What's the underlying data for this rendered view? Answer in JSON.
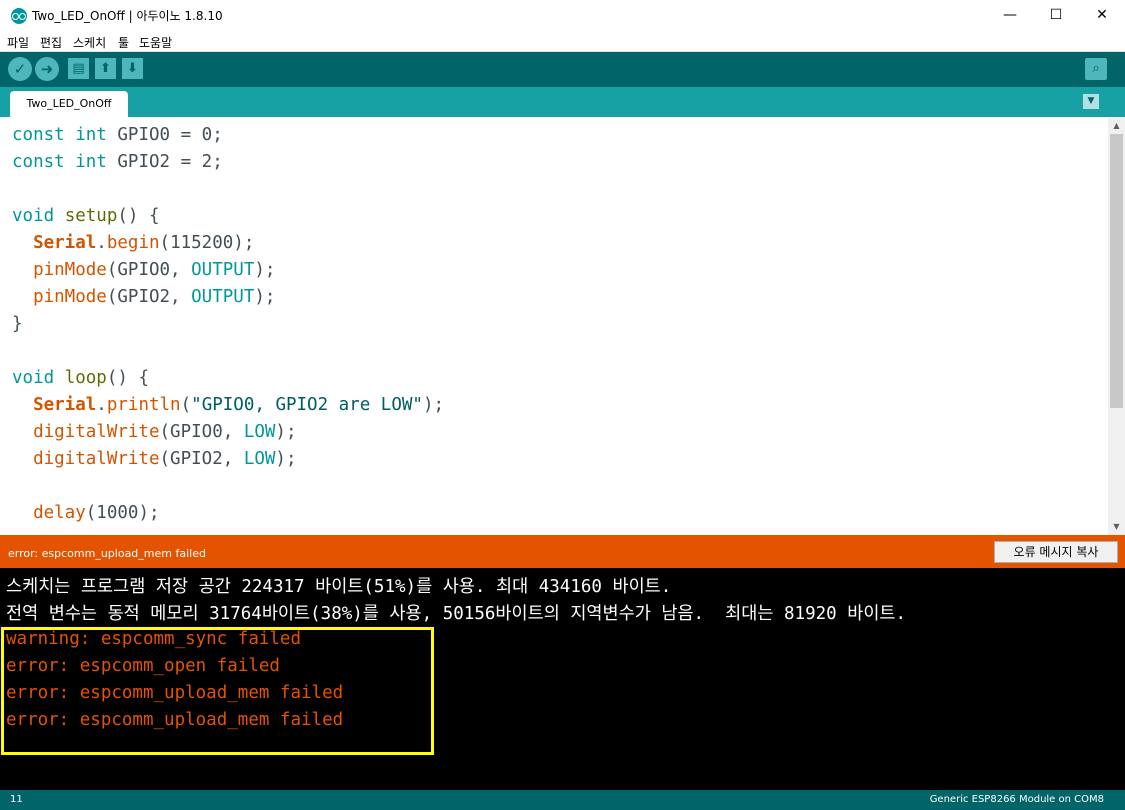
{
  "window": {
    "title": "Two_LED_OnOff | 아두이노 1.8.10",
    "controls": {
      "minimize": "—",
      "maximize": "☐",
      "close": "✕"
    }
  },
  "menu": [
    "파일",
    "편집",
    "스케치",
    "툴",
    "도움말"
  ],
  "toolbar": {
    "verify_icon": "check-icon",
    "upload_icon": "arrow-right-icon",
    "new_icon": "document-icon",
    "open_icon": "arrow-up-icon",
    "save_icon": "arrow-down-icon",
    "serial_monitor_icon": "magnifier-icon"
  },
  "tabs": [
    {
      "label": "Two_LED_OnOff"
    }
  ],
  "editor": {
    "lines": [
      [
        {
          "t": "const",
          "c": "k-type"
        },
        {
          "t": " "
        },
        {
          "t": "int",
          "c": "k-type"
        },
        {
          "t": " GPIO0 = 0;"
        }
      ],
      [
        {
          "t": "const",
          "c": "k-type"
        },
        {
          "t": " "
        },
        {
          "t": "int",
          "c": "k-type"
        },
        {
          "t": " GPIO2 = 2;"
        }
      ],
      [],
      [
        {
          "t": "void",
          "c": "k-type"
        },
        {
          "t": " "
        },
        {
          "t": "setup",
          "c": "k-struct"
        },
        {
          "t": "() {"
        }
      ],
      [
        {
          "t": "  "
        },
        {
          "t": "Serial",
          "c": "k-obj"
        },
        {
          "t": "."
        },
        {
          "t": "begin",
          "c": "k-fn"
        },
        {
          "t": "(115200);"
        }
      ],
      [
        {
          "t": "  "
        },
        {
          "t": "pinMode",
          "c": "k-fn"
        },
        {
          "t": "(GPIO0, "
        },
        {
          "t": "OUTPUT",
          "c": "k-const"
        },
        {
          "t": ");"
        }
      ],
      [
        {
          "t": "  "
        },
        {
          "t": "pinMode",
          "c": "k-fn"
        },
        {
          "t": "(GPIO2, "
        },
        {
          "t": "OUTPUT",
          "c": "k-const"
        },
        {
          "t": ");"
        }
      ],
      [
        {
          "t": "}"
        }
      ],
      [],
      [
        {
          "t": "void",
          "c": "k-type"
        },
        {
          "t": " "
        },
        {
          "t": "loop",
          "c": "k-struct"
        },
        {
          "t": "() {"
        }
      ],
      [
        {
          "t": "  "
        },
        {
          "t": "Serial",
          "c": "k-obj"
        },
        {
          "t": "."
        },
        {
          "t": "println",
          "c": "k-fn"
        },
        {
          "t": "("
        },
        {
          "t": "\"GPIO0, GPIO2 are LOW\"",
          "c": "k-str"
        },
        {
          "t": ");"
        }
      ],
      [
        {
          "t": "  "
        },
        {
          "t": "digitalWrite",
          "c": "k-fn"
        },
        {
          "t": "(GPIO0, "
        },
        {
          "t": "LOW",
          "c": "k-const"
        },
        {
          "t": ");"
        }
      ],
      [
        {
          "t": "  "
        },
        {
          "t": "digitalWrite",
          "c": "k-fn"
        },
        {
          "t": "(GPIO2, "
        },
        {
          "t": "LOW",
          "c": "k-const"
        },
        {
          "t": ");"
        }
      ],
      [],
      [
        {
          "t": "  "
        },
        {
          "t": "delay",
          "c": "k-fn"
        },
        {
          "t": "(1000);"
        }
      ]
    ]
  },
  "status": {
    "message": "error: espcomm_upload_mem failed",
    "copy_button": "오류 메시지 복사"
  },
  "console": {
    "lines": [
      {
        "text": "스케치는 프로그램 저장 공간 224317 바이트(51%)를 사용. 최대 434160 바이트.",
        "kind": "info"
      },
      {
        "text": "전역 변수는 동적 메모리 31764바이트(38%)를 사용, 50156바이트의 지역변수가 남음.  최대는 81920 바이트.",
        "kind": "info"
      },
      {
        "text": "warning: espcomm_sync failed",
        "kind": "error"
      },
      {
        "text": "error: espcomm_open failed",
        "kind": "error"
      },
      {
        "text": "error: espcomm_upload_mem failed",
        "kind": "error"
      },
      {
        "text": "error: espcomm_upload_mem failed",
        "kind": "error"
      }
    ]
  },
  "footer": {
    "line_number": "11",
    "board": "Generic ESP8266 Module on COM8"
  }
}
